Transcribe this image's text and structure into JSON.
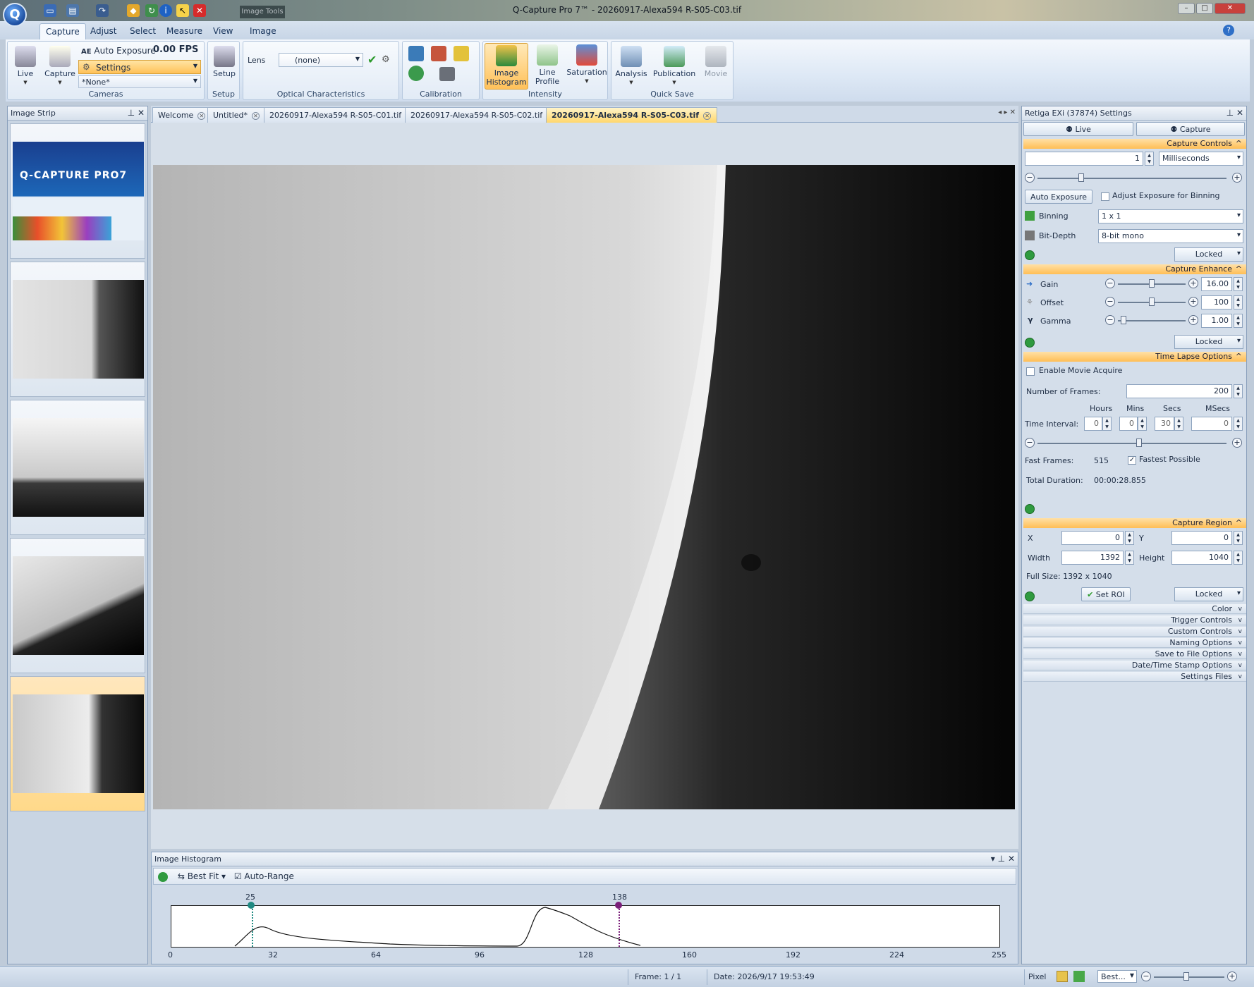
{
  "window": {
    "title": "Q-Capture Pro 7™ - 20260917-Alexa594 R-S05-C03.tif",
    "context_tab": "Image Tools"
  },
  "ribbon_tabs": [
    "Capture",
    "Adjust",
    "Select",
    "Measure",
    "View",
    "Image"
  ],
  "cameras": {
    "live": "Live",
    "capture": "Capture",
    "auto_exposure": "Auto Exposure",
    "fps": "0.00 FPS",
    "settings": "Settings",
    "preset": "*None*",
    "label": "Cameras"
  },
  "setup": {
    "button": "Setup",
    "label": "Setup"
  },
  "optical": {
    "lens_label": "Lens",
    "lens_value": "(none)",
    "label": "Optical Characteristics"
  },
  "calibration": {
    "label": "Calibration"
  },
  "intensity": {
    "histogram": "Image\nHistogram",
    "line_profile": "Line\nProfile",
    "saturation": "Saturation",
    "label": "Intensity"
  },
  "quick_save": {
    "analysis": "Analysis",
    "publication": "Publication",
    "movie": "Movie",
    "label": "Quick Save"
  },
  "image_strip": {
    "title": "Image Strip",
    "splash_brand": "Q-CAPTURE PRO7"
  },
  "doc_tabs": [
    "Welcome",
    "Untitled*",
    "20260917-Alexa594 R-S05-C01.tif",
    "20260917-Alexa594 R-S05-C02.tif",
    "20260917-Alexa594 R-S05-C03.tif"
  ],
  "histogram": {
    "title": "Image Histogram",
    "best_fit": "Best Fit",
    "auto_range": "Auto-Range",
    "low_marker": "25",
    "high_marker": "138",
    "ticks": [
      "0",
      "32",
      "64",
      "96",
      "128",
      "160",
      "192",
      "224",
      "255"
    ]
  },
  "settings_panel": {
    "title": "Retiga EXi (37874) Settings",
    "live": "Live",
    "capture": "Capture",
    "capture_controls": "Capture Controls",
    "exposure_value": "1",
    "exposure_unit": "Milliseconds",
    "auto_exposure": "Auto Exposure",
    "adjust_binning": "Adjust Exposure for Binning",
    "binning_label": "Binning",
    "binning_value": "1 x 1",
    "bitdepth_label": "Bit-Depth",
    "bitdepth_value": "8-bit mono",
    "locked": "Locked",
    "capture_enhance": "Capture Enhance",
    "gain_label": "Gain",
    "gain_value": "16.00",
    "offset_label": "Offset",
    "offset_value": "100",
    "gamma_label": "Gamma",
    "gamma_value": "1.00",
    "time_lapse": "Time Lapse Options",
    "enable_movie": "Enable Movie Acquire",
    "frames_label": "Number of  Frames:",
    "frames_value": "200",
    "hours": "Hours",
    "mins": "Mins",
    "secs": "Secs",
    "msecs": "MSecs",
    "interval_label": "Time Interval:",
    "h": "0",
    "m": "0",
    "s": "30",
    "ms": "0",
    "fast_frames_label": "Fast Frames:",
    "fast_frames_value": "515",
    "fastest": "Fastest Possible",
    "duration_label": "Total Duration:",
    "duration_value": "00:00:28.855",
    "capture_region": "Capture Region",
    "x_label": "X",
    "x_value": "0",
    "y_label": "Y",
    "y_value": "0",
    "width_label": "Width",
    "width_value": "1392",
    "height_label": "Height",
    "height_value": "1040",
    "full_size": "Full Size: 1392 x 1040",
    "set_roi": "Set ROI",
    "collapsed": [
      "Color",
      "Trigger Controls",
      "Custom Controls",
      "Naming Options",
      "Save to File Options",
      "Date/Time Stamp Options",
      "Settings Files"
    ]
  },
  "status": {
    "frame": "Frame: 1 / 1",
    "date": "Date: 2026/9/17 19:53:49",
    "pixel": "Pixel",
    "zoom": "Best..."
  },
  "colors": {
    "accent": "#ffbe55",
    "ribbon": "#dde8f5",
    "marker_low": "#1f8a82",
    "marker_high": "#7b1f7a"
  }
}
